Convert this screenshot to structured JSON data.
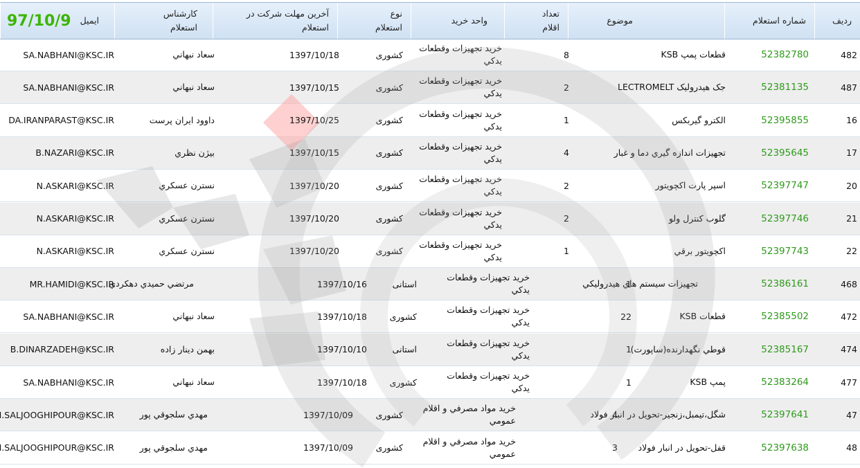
{
  "header": {
    "col_row": "ردیف",
    "col_number": "شماره استعلام",
    "col_subject": "موضوع",
    "col_count": "تعداد اقلام",
    "col_unit": "واحد خرید",
    "col_type": "نوع استعلام",
    "col_deadline": "آخرین مهلت شرکت در استعلام",
    "col_expert": "کارشناس استعلام",
    "col_email": "ایمیل",
    "date_badge": "97/10/9"
  },
  "rows": [
    {
      "radif": "482",
      "number": "52382780",
      "subject": "قطعات پمپ KSB",
      "count": "8",
      "unit": "خريد تجهيزات وقطعات يدکي",
      "type": "کشوری",
      "deadline": "1397/10/18",
      "expert": "سعاد نبهاني",
      "email": "SA.NABHANI@KSC.IR"
    },
    {
      "radif": "487",
      "number": "52381135",
      "subject": "جک هيدروليک LECTROMELT",
      "count": "2",
      "unit": "خريد تجهيزات وقطعات يدکي",
      "type": "کشوری",
      "deadline": "1397/10/15",
      "expert": "سعاد نبهاني",
      "email": "SA.NABHANI@KSC.IR"
    },
    {
      "radif": "16",
      "number": "52395855",
      "subject": "الکترو گيربکس",
      "count": "1",
      "unit": "خريد تجهيزات وقطعات يدکي",
      "type": "کشوری",
      "deadline": "1397/10/25",
      "expert": "داوود ايران پرست",
      "email": "DA.IRANPARAST@KSC.IR"
    },
    {
      "radif": "17",
      "number": "52395645",
      "subject": "تجهيزات اندازه گيري دما و غبار",
      "count": "4",
      "unit": "خريد تجهيزات وقطعات يدکي",
      "type": "کشوری",
      "deadline": "1397/10/15",
      "expert": "بيژن نظري",
      "email": "B.NAZARI@KSC.IR"
    },
    {
      "radif": "20",
      "number": "52397747",
      "subject": "اسپر پارت اکچويتور",
      "count": "2",
      "unit": "خريد تجهيزات وقطعات يدکي",
      "type": "کشوری",
      "deadline": "1397/10/20",
      "expert": "نسترن عسکري",
      "email": "N.ASKARI@KSC.IR"
    },
    {
      "radif": "21",
      "number": "52397746",
      "subject": "گلوب کنترل ولو",
      "count": "2",
      "unit": "خريد تجهيزات وقطعات يدکي",
      "type": "کشوری",
      "deadline": "1397/10/20",
      "expert": "نسترن عسکري",
      "email": "N.ASKARI@KSC.IR"
    },
    {
      "radif": "22",
      "number": "52397743",
      "subject": "اکچويتور برقي",
      "count": "1",
      "unit": "خريد تجهيزات وقطعات يدکي",
      "type": "کشوری",
      "deadline": "1397/10/20",
      "expert": "نسترن عسکري",
      "email": "N.ASKARI@KSC.IR"
    },
    {
      "radif": "468",
      "number": "52386161",
      "subject": "تجهيزات سيستم هاي هيدروليکي",
      "count": "1",
      "unit": "خريد تجهيزات وقطعات يدکي",
      "type": "استانی",
      "deadline": "1397/10/16",
      "expert": "مرتضي حميدي دهکردي",
      "email": "MR.HAMIDI@KSC.IR"
    },
    {
      "radif": "472",
      "number": "52385502",
      "subject": "قطعات KSB",
      "count": "22",
      "unit": "خريد تجهيزات وقطعات يدکي",
      "type": "کشوری",
      "deadline": "1397/10/18",
      "expert": "سعاد نبهاني",
      "email": "SA.NABHANI@KSC.IR"
    },
    {
      "radif": "474",
      "number": "52385167",
      "subject": "قوطي نگهدارنده(ساپورت)",
      "count": "1",
      "unit": "خريد تجهيزات وقطعات يدکي",
      "type": "استانی",
      "deadline": "1397/10/10",
      "expert": "بهمن دينار زاده",
      "email": "B.DINARZADEH@KSC.IR"
    },
    {
      "radif": "477",
      "number": "52383264",
      "subject": "پمپ KSB",
      "count": "1",
      "unit": "خريد تجهيزات وقطعات يدکي",
      "type": "کشوری",
      "deadline": "1397/10/18",
      "expert": "سعاد نبهاني",
      "email": "SA.NABHANI@KSC.IR"
    },
    {
      "radif": "47",
      "number": "52397641",
      "subject": "شگل،تيمبل،زنجير-تحويل در انبار فولاد",
      "count": "4",
      "unit": "خريد مواد مصرفي و اقلام عمومي",
      "type": "کشوری",
      "deadline": "1397/10/09",
      "expert": "مهدي سلجوقي پور",
      "email": "M.SALJOOGHIPOUR@KSC.IR"
    },
    {
      "radif": "48",
      "number": "52397638",
      "subject": "قفل-تحويل در انبار فولاد",
      "count": "3",
      "unit": "خريد مواد مصرفي و اقلام عمومي",
      "type": "کشوری",
      "deadline": "1397/10/09",
      "expert": "مهدي سلجوقي پور",
      "email": "M.SALJOOGHIPOUR@KSC.IR"
    }
  ]
}
